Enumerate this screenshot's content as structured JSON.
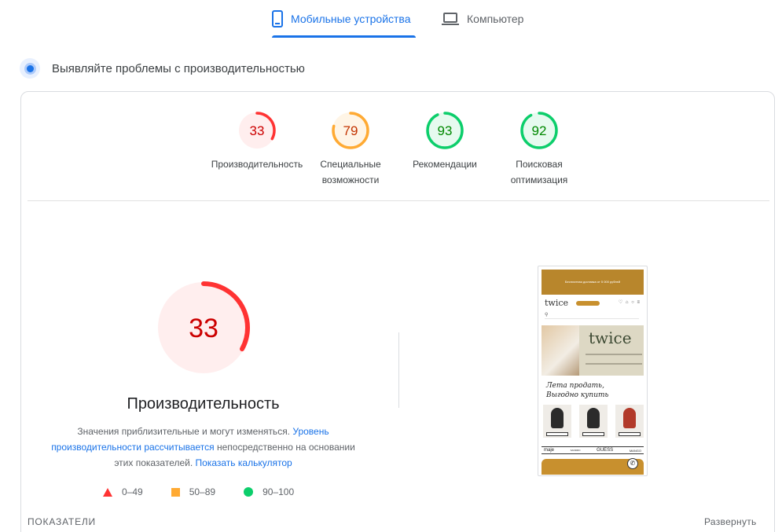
{
  "tabs": {
    "mobile": {
      "label": "Мобильные устройства",
      "icon": "smartphone-icon",
      "active": true
    },
    "desktop": {
      "label": "Компьютер",
      "icon": "laptop-icon",
      "active": false
    }
  },
  "section": {
    "title": "Выявляйте проблемы с производительностью",
    "icon": "pulse-icon"
  },
  "colors": {
    "fail": "#ff3333",
    "average": "#ffaa33",
    "pass": "#0cce6b",
    "link": "#1a73e8"
  },
  "gauges": [
    {
      "id": "performance",
      "score": "33",
      "label_line1": "Производительность",
      "label_line2": "",
      "status": "fail"
    },
    {
      "id": "accessibility",
      "score": "79",
      "label_line1": "Специальные",
      "label_line2": "возможности",
      "status": "average"
    },
    {
      "id": "best-practices",
      "score": "93",
      "label_line1": "Рекомендации",
      "label_line2": "",
      "status": "pass"
    },
    {
      "id": "seo",
      "score": "92",
      "label_line1": "Поисковая",
      "label_line2": "оптимизация",
      "status": "pass"
    }
  ],
  "performance": {
    "score": "33",
    "title": "Производительность",
    "note_prefix": "Значения приблизительные и могут изменяться.",
    "note_link1": "Уровень производительности рассчитывается",
    "note_middle": "непосредственно на основании этих показателей.",
    "note_link2": "Показать калькулятор"
  },
  "legend": [
    {
      "shape": "triangle",
      "range": "0–49"
    },
    {
      "shape": "square",
      "range": "50–89"
    },
    {
      "shape": "circle",
      "range": "90–100"
    }
  ],
  "screenshot": {
    "banner": "Бесплатная доставка от 5 000 рублей",
    "logo": "twice",
    "hero_logo": "twice",
    "script_line1": "Лета продать,",
    "script_line2": "Выгодно купить",
    "brands": [
      "maje",
      "SANDRO",
      "GUESS",
      "MANGO"
    ]
  },
  "footer": {
    "metrics_label": "ПОКАЗАТЕЛИ",
    "expand_label": "Развернуть"
  }
}
